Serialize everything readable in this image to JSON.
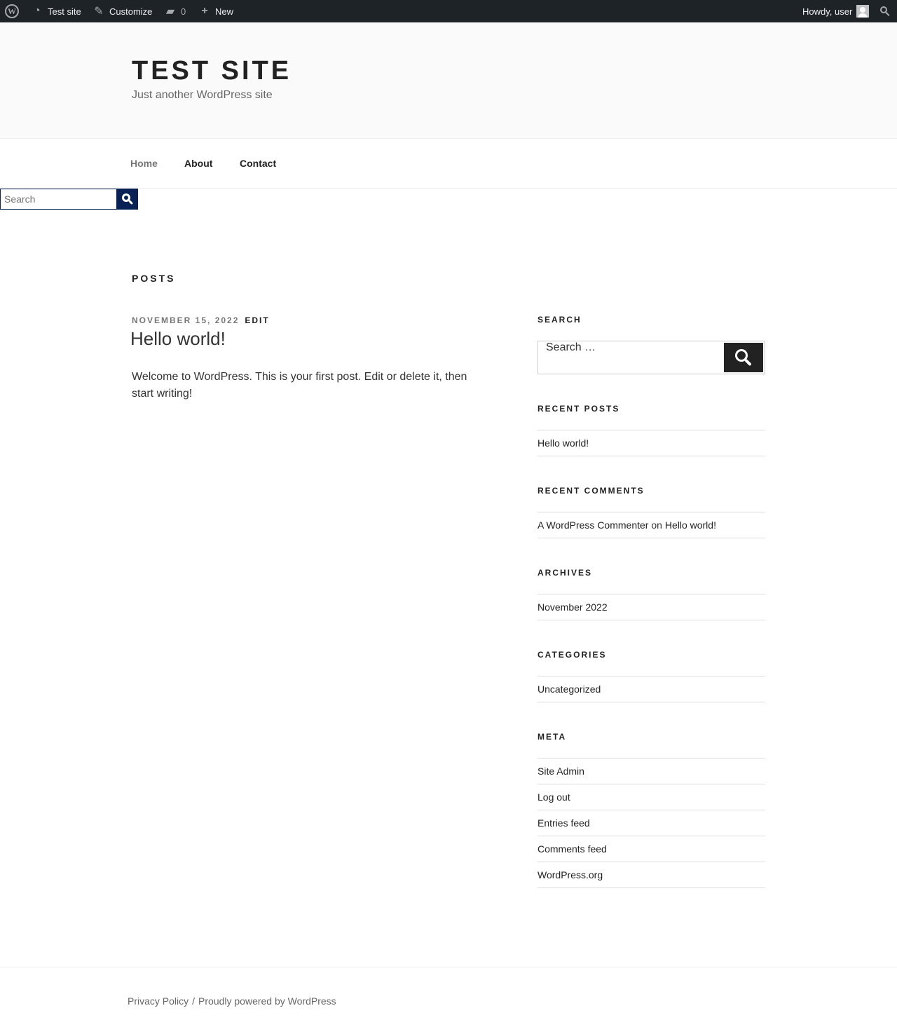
{
  "admin_bar": {
    "logo": "W",
    "site_name": "Test site",
    "customize": "Customize",
    "comments_count": "0",
    "new_label": "New",
    "greeting": "Howdy, user"
  },
  "header": {
    "title": "Test site",
    "description": "Just another WordPress site"
  },
  "nav": {
    "items": [
      "Home",
      "About",
      "Contact"
    ]
  },
  "mini_search": {
    "placeholder": "Search"
  },
  "main": {
    "heading": "POSTS",
    "post": {
      "date": "NOVEMBER 15, 2022",
      "edit": "EDIT",
      "title": "Hello world!",
      "body": "Welcome to WordPress. This is your first post. Edit or delete it, then start writing!"
    }
  },
  "sidebar": {
    "search_title": "SEARCH",
    "search_placeholder": "Search …",
    "recent_posts_title": "RECENT POSTS",
    "recent_posts": [
      "Hello world!"
    ],
    "recent_comments_title": "RECENT COMMENTS",
    "recent_comment": {
      "author": "A WordPress Commenter",
      "on": "on",
      "post": "Hello world!"
    },
    "archives_title": "ARCHIVES",
    "archives": [
      "November 2022"
    ],
    "categories_title": "CATEGORIES",
    "categories": [
      "Uncategorized"
    ],
    "meta_title": "META",
    "meta": [
      "Site Admin",
      "Log out",
      "Entries feed",
      "Comments feed",
      "WordPress.org"
    ]
  },
  "footer": {
    "privacy": "Privacy Policy",
    "separator": "/",
    "powered": "Proudly powered by WordPress"
  },
  "colors": {
    "admin_bar_bg": "#1d2327",
    "header_bg": "#fafafa",
    "mini_search_accent": "#0a2156",
    "search_button": "#222222"
  }
}
